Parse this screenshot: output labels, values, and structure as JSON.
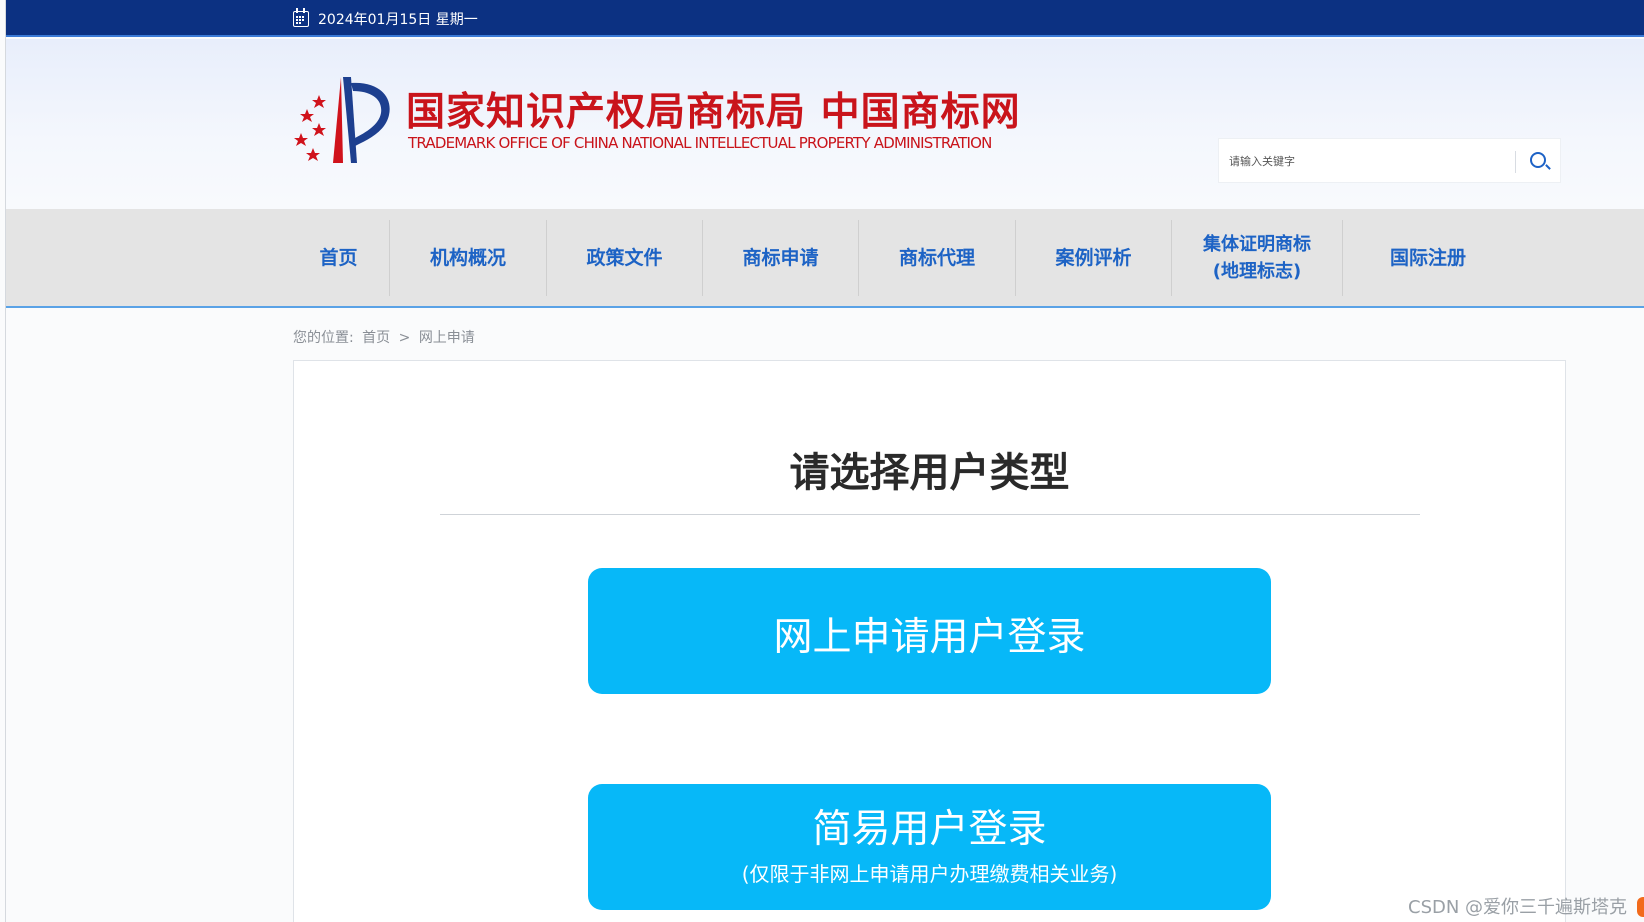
{
  "topbar": {
    "date": "2024年01月15日 星期一",
    "calendar_icon": "calendar-icon",
    "background": "#0c3182"
  },
  "header": {
    "logo_cn": "国家知识产权局商标局 中国商标网",
    "logo_en": "TRADEMARK OFFICE OF CHINA NATIONAL INTELLECTUAL PROPERTY ADMINISTRATION",
    "logo_color": "#c9141b",
    "search": {
      "placeholder": "请输入关键字",
      "icon": "search-icon"
    }
  },
  "nav": {
    "items": [
      {
        "label": "首页"
      },
      {
        "label": "机构概况"
      },
      {
        "label": "政策文件"
      },
      {
        "label": "商标申请"
      },
      {
        "label": "商标代理"
      },
      {
        "label": "案例评析"
      },
      {
        "label": "集体证明商标\n(地理标志)"
      },
      {
        "label": "国际注册"
      }
    ],
    "text_color": "#1d63c5"
  },
  "breadcrumb": {
    "prefix": "您的位置:",
    "home": "首页",
    "separator": ">",
    "current": "网上申请"
  },
  "panel": {
    "title": "请选择用户类型",
    "online_login": "网上申请用户登录",
    "simple_login": "简易用户登录",
    "simple_login_note": "(仅限于非网上申请用户办理缴费相关业务)",
    "button_color": "#07b8f8"
  },
  "watermark": "CSDN @爱你三千遍斯塔克"
}
